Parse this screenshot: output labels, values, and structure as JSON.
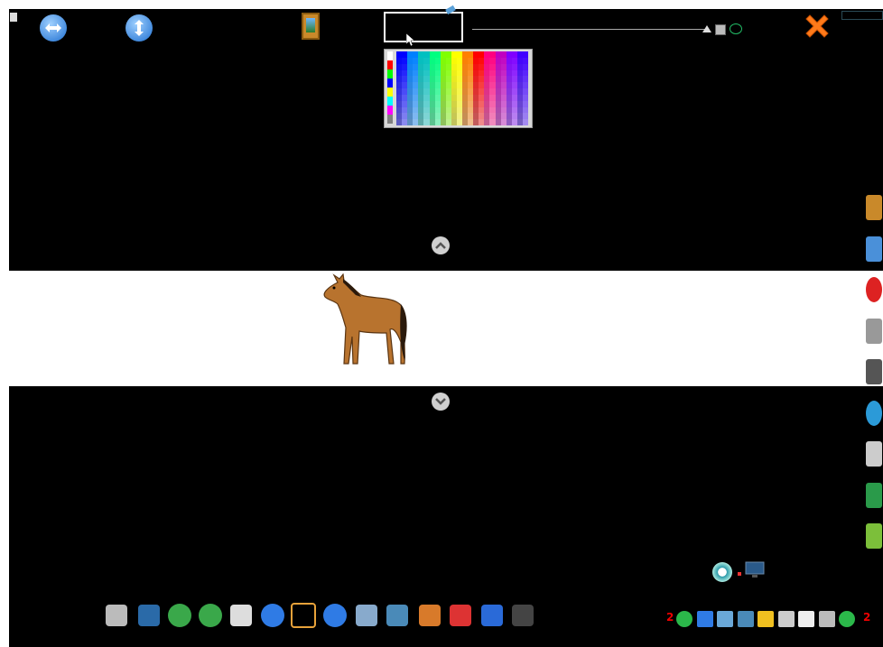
{
  "colors": {
    "background": "#000000",
    "strip": "#ffffff",
    "accent_blue": "#2f7be5",
    "close_orange": "#ff7a1a",
    "green": "#2bb84a"
  },
  "top_bar": {
    "menu_icon": "menu-square-icon",
    "horizontal_arrows_icon": "horizontal-arrows-icon",
    "vertical_arrows_icon": "vertical-arrows-icon",
    "picture_icon": "picture-frame-icon",
    "close_icon": "close-x-icon"
  },
  "color_picker": {
    "current_color": "#000000",
    "side_swatches": [
      "#ffffff",
      "#ff0000",
      "#00ff00",
      "#0000ff",
      "#ffff00",
      "#00ffff",
      "#ff00ff",
      "#808080"
    ],
    "hues": [
      "#0000ff",
      "#0080ff",
      "#00c0c0",
      "#00ff80",
      "#80ff00",
      "#ffff00",
      "#ff8000",
      "#ff0000",
      "#ff0080",
      "#c000c0",
      "#8000ff",
      "#4000ff"
    ]
  },
  "toolbar": {
    "items": [
      "speaker-icon",
      "move-icon",
      "undo-icon",
      "redo-icon",
      "notepad-icon",
      "prev-page-icon",
      "add-page-icon",
      "next-page-icon",
      "book-icon",
      "keyboard-icon",
      "scissors-icon",
      "eraser-icon",
      "pen-icon",
      "ruler-icon"
    ]
  },
  "side_panel": {
    "items": [
      "picture-icon",
      "document-icon",
      "help-icon",
      "microphone-icon",
      "film-icon",
      "globe-icon",
      "webcam-icon",
      "tools-icon",
      "cube-icon"
    ]
  },
  "bottom_right": {
    "left_number": "2",
    "right_number": "2",
    "items": [
      "play-icon",
      "hand-icon",
      "video-icon",
      "grid-icon",
      "expand-icon",
      "cut-icon",
      "copy-icon",
      "camera-icon",
      "gem-icon"
    ]
  },
  "nav": {
    "up_icon": "chevron-up-icon",
    "down_icon": "chevron-down-icon",
    "record_icon": "record-icon",
    "monitor_icon": "monitor-icon"
  }
}
